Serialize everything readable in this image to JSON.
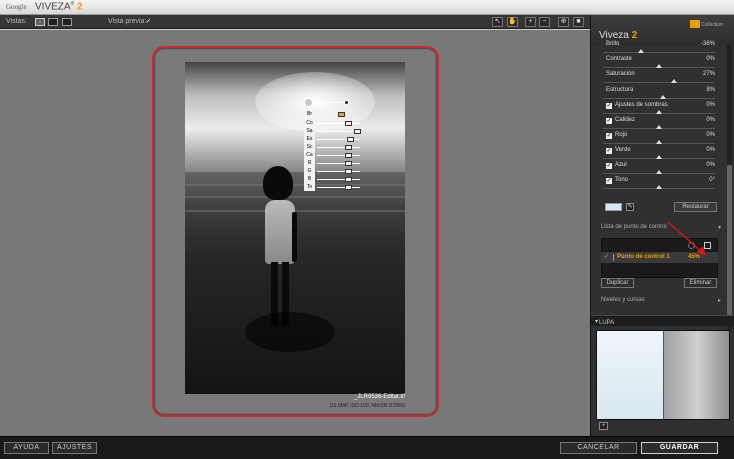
{
  "titlebar": {
    "brand": "Google",
    "app_name": "VIVEZA",
    "app_version": "2"
  },
  "toolbar": {
    "views_label": "Vistas:",
    "preview_label": "Vista previa:",
    "preview_checked": "✓"
  },
  "canvas": {
    "filename": "_JLR9536-Editar.tif",
    "fileinfo": "(11.9MP, ISO 100, NIKON D7000)",
    "control_point_labels": [
      "Br",
      "Co",
      "Sa",
      "Es",
      "Sc",
      "Ca",
      "R",
      "G",
      "B",
      "To"
    ]
  },
  "panel": {
    "title": "Viveza",
    "version": "2",
    "collection": "Collection",
    "sliders": [
      {
        "name": "Brillo",
        "value": "-36%",
        "checkbox": false
      },
      {
        "name": "Contraste",
        "value": "0%",
        "checkbox": false
      },
      {
        "name": "Saturación",
        "value": "27%",
        "checkbox": false
      },
      {
        "name": "Estructura",
        "value": "8%",
        "checkbox": false
      },
      {
        "name": "Ajustes de sombras",
        "value": "0%",
        "checkbox": true
      },
      {
        "name": "Calidez",
        "value": "0%",
        "checkbox": true
      },
      {
        "name": "Rojo",
        "value": "0%",
        "checkbox": true
      },
      {
        "name": "Verde",
        "value": "0%",
        "checkbox": true
      },
      {
        "name": "Azul",
        "value": "0%",
        "checkbox": true
      },
      {
        "name": "Tono",
        "value": "0°",
        "checkbox": true
      }
    ],
    "checkbox_glyph": "✓",
    "restore_label": "Restaurar",
    "cp_list_title": "Lista de punto de control",
    "cp_item_name": "Punto de control 1",
    "cp_item_value": "45%",
    "duplicate_label": "Duplicar",
    "delete_label": "Eliminar",
    "levels_title": "Niveles y curvas",
    "loupe_title": "LUPA",
    "loupe_button": "+"
  },
  "bottombar": {
    "help_label": "AYUDA",
    "settings_label": "AJUSTES",
    "cancel_label": "CANCELAR",
    "save_label": "GUARDAR"
  },
  "colors": {
    "accent": "#e8a000",
    "highlight_frame": "#d0282c",
    "swatch": "#d5e9f5"
  }
}
